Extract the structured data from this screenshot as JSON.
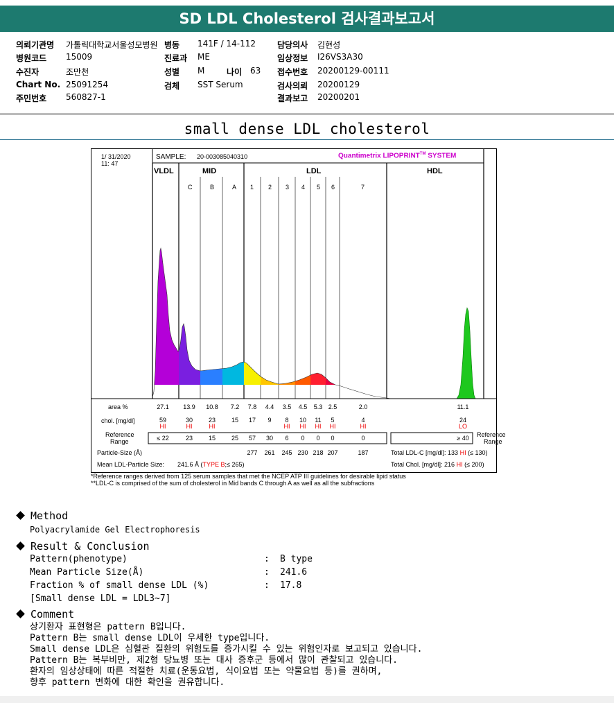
{
  "header": {
    "title": "SD LDL Cholesterol 검사결과보고서"
  },
  "patient_info": {
    "col1": [
      {
        "label": "의뢰기관명",
        "value": "가톨릭대학교서울성모병원"
      },
      {
        "label": "병원코드",
        "value": "15009"
      },
      {
        "label": "수진자",
        "value": "조만천"
      },
      {
        "label": "Chart No.",
        "value": "25091254"
      },
      {
        "label": "주민번호",
        "value": "560827-1"
      }
    ],
    "col2": [
      {
        "label": "병동",
        "value": "141F / 14-112"
      },
      {
        "label": "진료과",
        "value": "ME"
      },
      {
        "label": "성별",
        "value": "M"
      },
      {
        "label": "검체",
        "value": "SST Serum"
      }
    ],
    "age_label": "나이",
    "age_value": "63",
    "col3": [
      {
        "label": "담당의사",
        "value": "김현성"
      },
      {
        "label": "임상정보",
        "value": "I26VS3A30"
      },
      {
        "label": "접수번호",
        "value": "20200129-00111"
      },
      {
        "label": "검사의뢰",
        "value": "20200129"
      },
      {
        "label": "결과보고",
        "value": "20200201"
      }
    ]
  },
  "report": {
    "subtitle": "small dense LDL cholesterol",
    "date": "1/ 31/2020",
    "time": "11: 47",
    "sample_label": "SAMPLE:",
    "sample_id": "20-003085040310",
    "brand": "Quantimetrix LIPOPRINT",
    "brand_tm": "TM",
    "brand_suffix": " SYSTEM",
    "groups": {
      "vldl": "VLDL",
      "mid": "MID",
      "ldl": "LDL",
      "hdl": "HDL"
    },
    "bands": [
      "C",
      "B",
      "A",
      "1",
      "2",
      "3",
      "4",
      "5",
      "6",
      "7"
    ],
    "row_labels": {
      "area": "area %",
      "chol": "chol. [mg/dl]",
      "reference": "Reference",
      "range": "Range",
      "particle_size": "Particle-Size (Å)",
      "mean_particle": "Mean LDL-Particle Size:",
      "total_ldl": "Total LDL-C [mg/dl]:",
      "total_chol": "Total Chol. [mg/dl]:"
    },
    "area_values": [
      "27.1",
      "13.9",
      "10.8",
      "7.2",
      "7.8",
      "4.4",
      "3.5",
      "4.5",
      "5.3",
      "2.5",
      "2.0",
      "11.1"
    ],
    "chol_values": [
      "59",
      "30",
      "23",
      "15",
      "17",
      "9",
      "8",
      "10",
      "11",
      "5",
      "4",
      "24"
    ],
    "chol_flags": [
      "HI",
      "HI",
      "HI",
      "",
      "",
      "",
      "HI",
      "HI",
      "HI",
      "HI",
      "HI",
      "LO"
    ],
    "ref_values": [
      "≤ 22",
      "23",
      "15",
      "25",
      "57",
      "30",
      "6",
      "0",
      "0",
      "0",
      "0",
      "≥ 40"
    ],
    "particle_sizes": [
      "277",
      "261",
      "245",
      "230",
      "218",
      "207",
      "187"
    ],
    "mean_particle_value": "241.6 Å",
    "mean_particle_type": "TYPE B",
    "mean_particle_ref": "≤ 265",
    "total_ldl_value": "133",
    "total_ldl_flag": "HI",
    "total_ldl_ref": "(≤ 130)",
    "total_chol_value": "216",
    "total_chol_flag": "HI",
    "total_chol_ref": "(≤ 200)",
    "footnote1": "*Reference ranges derived from 125 serum samples that met the NCEP ATP III guidelines for desirable lipid status",
    "footnote2": "**LDL-C is comprised of the sum of cholesterol in Mid bands C through A as well as all the subfractions"
  },
  "method": {
    "heading": "Method",
    "text": "Polyacrylamide Gel Electrophoresis"
  },
  "result": {
    "heading": "Result & Conclusion",
    "rows": [
      {
        "label": "Pattern(phenotype)",
        "value": "B type"
      },
      {
        "label": "Mean Particle Size(Å)",
        "value": "241.6"
      },
      {
        "label": "Fraction % of small dense LDL (%)",
        "value": "17.8"
      }
    ],
    "note": "[Small dense LDL = LDL3~7]",
    "sep": ":"
  },
  "comment": {
    "heading": "Comment",
    "lines": [
      "상기환자 표현형은 pattern B입니다.",
      "Pattern B는 small dense LDL이 우세한 type입니다.",
      "Small dense LDL은 심혈관 질환의 위험도를 증가시킬 수 있는 위험인자로 보고되고 있습니다.",
      "Pattern B는 복부비만, 제2형 당뇨병 또는 대사 증후군 등에서 많이 관찰되고 있습니다.",
      "환자의 임상상태에 따른 적절한 치료(운동요법, 식이요법 또는 약물요법 등)를 권하며,",
      "향후 pattern 변화에 대한 확인을 권유합니다."
    ]
  },
  "colors": {
    "header_bg": "#1d7a6f",
    "flag": "#e00000",
    "brand": "#cc00cc"
  }
}
